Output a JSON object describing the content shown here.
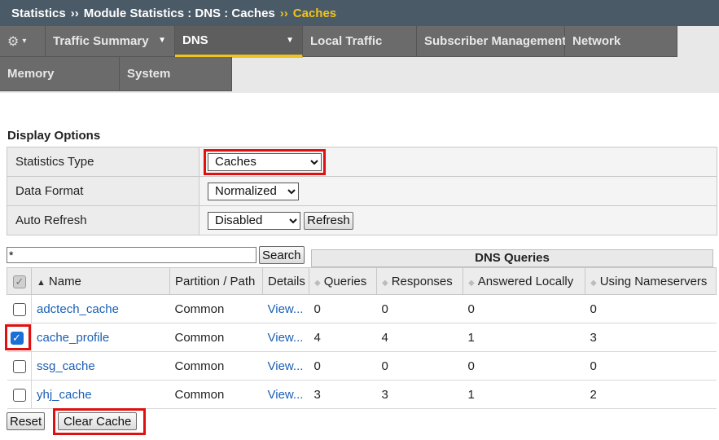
{
  "breadcrumb": {
    "items": [
      "Statistics",
      "Module Statistics : DNS : Caches"
    ],
    "separator": "››",
    "current": "Caches"
  },
  "tabs": {
    "gear_caret": "▾",
    "row1": [
      {
        "label": "Traffic Summary",
        "has_menu": true
      },
      {
        "label": "DNS",
        "has_menu": true,
        "active": true
      },
      {
        "label": "Local Traffic"
      },
      {
        "label": "Subscriber Management"
      },
      {
        "label": "Network"
      }
    ],
    "row2": [
      {
        "label": "Memory"
      },
      {
        "label": "System"
      }
    ]
  },
  "display_options": {
    "title": "Display Options",
    "statistics_type": {
      "label": "Statistics Type",
      "value": "Caches"
    },
    "data_format": {
      "label": "Data Format",
      "value": "Normalized"
    },
    "auto_refresh": {
      "label": "Auto Refresh",
      "value": "Disabled",
      "button": "Refresh"
    }
  },
  "search": {
    "value": "*",
    "button": "Search"
  },
  "dns_queries_header": "DNS Queries",
  "columns": [
    "Name",
    "Partition / Path",
    "Details",
    "Queries",
    "Responses",
    "Answered Locally",
    "Using Nameservers"
  ],
  "rows": [
    {
      "checked": false,
      "name": "adctech_cache",
      "partition": "Common",
      "details": "View...",
      "queries": "0",
      "responses": "0",
      "answered_locally": "0",
      "using_nameservers": "0"
    },
    {
      "checked": true,
      "name": "cache_profile",
      "partition": "Common",
      "details": "View...",
      "queries": "4",
      "responses": "4",
      "answered_locally": "1",
      "using_nameservers": "3"
    },
    {
      "checked": false,
      "name": "ssg_cache",
      "partition": "Common",
      "details": "View...",
      "queries": "0",
      "responses": "0",
      "answered_locally": "0",
      "using_nameservers": "0"
    },
    {
      "checked": false,
      "name": "yhj_cache",
      "partition": "Common",
      "details": "View...",
      "queries": "3",
      "responses": "3",
      "answered_locally": "1",
      "using_nameservers": "2"
    }
  ],
  "buttons": {
    "reset": "Reset",
    "clear_cache": "Clear Cache"
  },
  "colors": {
    "header_bg": "#4b5a67",
    "accent": "#f0c419",
    "link": "#1a5fb4",
    "highlight": "#e01010"
  }
}
